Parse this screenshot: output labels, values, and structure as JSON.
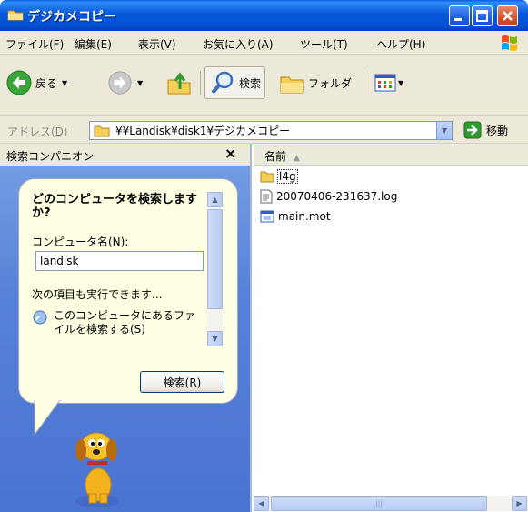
{
  "window": {
    "title": "デジカメコピー"
  },
  "menu": {
    "items": [
      "ファイル(F)",
      "編集(E)",
      "表示(V)",
      "お気に入り(A)",
      "ツール(T)",
      "ヘルプ(H)"
    ]
  },
  "toolbar": {
    "back_label": "戻る",
    "search_label": "検索",
    "folders_label": "フォルダ"
  },
  "address": {
    "label": "アドレス(D)",
    "value": "¥¥Landisk¥disk1¥デジカメコピー",
    "go_label": "移動"
  },
  "search_pane": {
    "title": "検索コンパニオン",
    "close_glyph": "×",
    "question": "どのコンピュータを検索しますか?",
    "computer_label": "コンピュータ名(N):",
    "computer_value": "landisk",
    "next_label": "次の項目も実行できます...",
    "task_label": "このコンピュータにあるファイルを検索する(S)",
    "search_button": "検索(R)"
  },
  "file_pane": {
    "column_name": "名前",
    "files": [
      {
        "name": "l4g",
        "type": "folder-icon"
      },
      {
        "name": "20070406-231637.log",
        "type": "text-file-icon"
      },
      {
        "name": "main.mot",
        "type": "app-file-icon"
      }
    ]
  },
  "colors": {
    "titlebar": "#0858dc",
    "chrome": "#ece9d8",
    "pane_blue": "#5782d8",
    "balloon": "#ffffe4"
  }
}
